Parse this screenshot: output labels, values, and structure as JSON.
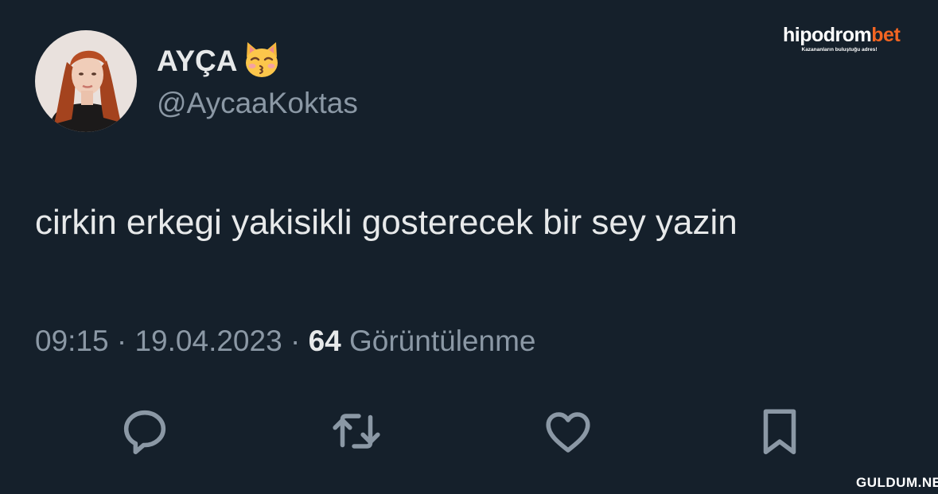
{
  "author": {
    "display_name": "AYÇA",
    "name_emoji": "kissing-cat-emoji",
    "handle": "@AycaaKoktas",
    "avatar": "profile-photo-avatar"
  },
  "tweet": {
    "text": "cirkin erkegi yakisikli gosterecek bir sey yazin"
  },
  "meta": {
    "time": "09:15",
    "separator_1": " · ",
    "date": "19.04.2023",
    "separator_2": " · ",
    "views_count": "64",
    "views_label": " Görüntülenme"
  },
  "actions": [
    {
      "icon": "reply-icon"
    },
    {
      "icon": "retweet-icon"
    },
    {
      "icon": "like-icon"
    },
    {
      "icon": "bookmark-icon"
    }
  ],
  "brand_logo": {
    "name_main": "hipodrom",
    "name_accent": "bet",
    "tagline": "Kazananların buluştuğu adres!",
    "accent_color": "#f26522"
  },
  "watermark": {
    "text": "GULDUM.NET"
  },
  "colors": {
    "background": "#15202b",
    "primary_text": "#e7e9ea",
    "secondary_text": "#8b98a5"
  }
}
